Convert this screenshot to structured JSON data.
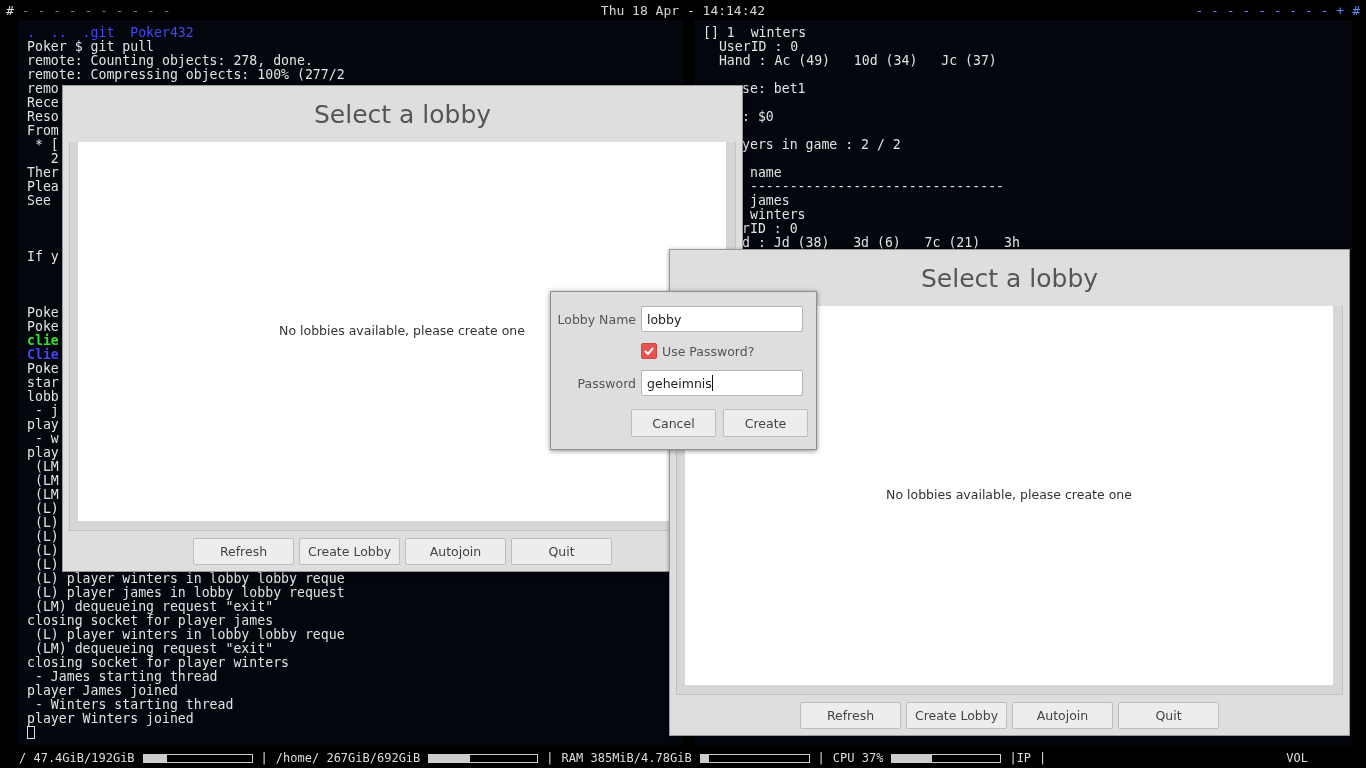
{
  "top_bar": {
    "left_mark": "#",
    "left_tags": "- - - - - - - - - -",
    "clock": "Thu 18 Apr - 14:14:42",
    "right_tags": "- - - - - - - - - +",
    "right_mark": "#"
  },
  "left_terminal": {
    "cursor_visible": true,
    "lines": [
      {
        "kind": "listing",
        "text": ".  ..  .git  Poker432"
      },
      {
        "kind": "plain",
        "text": "Poker $ git pull"
      },
      {
        "kind": "plain",
        "text": "remote: Counting objects: 278, done."
      },
      {
        "kind": "plain",
        "text": "remote: Compressing objects: 100% (277/2"
      },
      {
        "kind": "plain",
        "text": "remo"
      },
      {
        "kind": "plain",
        "text": "Rece"
      },
      {
        "kind": "plain",
        "text": "Reso"
      },
      {
        "kind": "plain",
        "text": "From"
      },
      {
        "kind": "plain",
        "text": " * ["
      },
      {
        "kind": "plain",
        "text": "   2"
      },
      {
        "kind": "plain",
        "text": "Ther"
      },
      {
        "kind": "plain",
        "text": "Plea"
      },
      {
        "kind": "plain",
        "text": "See"
      },
      {
        "kind": "blank"
      },
      {
        "kind": "blank"
      },
      {
        "kind": "blank"
      },
      {
        "kind": "plain",
        "text": "If y"
      },
      {
        "kind": "blank"
      },
      {
        "kind": "blank"
      },
      {
        "kind": "blank"
      },
      {
        "kind": "plain",
        "text": "Poke"
      },
      {
        "kind": "plain",
        "text": "Poke"
      },
      {
        "kind": "success",
        "text": "clie"
      },
      {
        "kind": "info",
        "text": "Clie"
      },
      {
        "kind": "plain",
        "text": "Poke"
      },
      {
        "kind": "plain",
        "text": "star"
      },
      {
        "kind": "plain",
        "text": "lobb"
      },
      {
        "kind": "plain",
        "text": " - j"
      },
      {
        "kind": "plain",
        "text": "play"
      },
      {
        "kind": "plain",
        "text": " - w"
      },
      {
        "kind": "plain",
        "text": "play"
      },
      {
        "kind": "plain",
        "text": " (LM"
      },
      {
        "kind": "plain",
        "text": " (LM"
      },
      {
        "kind": "plain",
        "text": " (LM"
      },
      {
        "kind": "plain",
        "text": " (L)"
      },
      {
        "kind": "plain",
        "text": " (L)"
      },
      {
        "kind": "plain",
        "text": " (L)"
      },
      {
        "kind": "plain",
        "text": " (L)"
      },
      {
        "kind": "plain",
        "text": " (L)"
      },
      {
        "kind": "plain",
        "text": " (L) player winters in lobby lobby reque"
      },
      {
        "kind": "plain",
        "text": " (L) player james in lobby lobby request"
      },
      {
        "kind": "plain",
        "text": " (LM) dequeueing request \"exit\""
      },
      {
        "kind": "plain",
        "text": "closing socket for player james"
      },
      {
        "kind": "plain",
        "text": " (L) player winters in lobby lobby reque"
      },
      {
        "kind": "plain",
        "text": " (LM) dequeueing request \"exit\""
      },
      {
        "kind": "plain",
        "text": "closing socket for player winters"
      },
      {
        "kind": "plain",
        "text": " - James starting thread"
      },
      {
        "kind": "plain",
        "text": "player James joined"
      },
      {
        "kind": "plain",
        "text": " - Winters starting thread"
      },
      {
        "kind": "plain",
        "text": "player Winters joined"
      }
    ]
  },
  "right_terminal": {
    "lines": [
      {
        "kind": "plain",
        "text": "[] 1  winters"
      },
      {
        "kind": "plain",
        "text": "  UserID : 0"
      },
      {
        "kind": "plain",
        "text": "  Hand : Ac (49)   10d (34)   Jc (37)"
      },
      {
        "kind": "blank"
      },
      {
        "kind": "plain",
        "text": "se: bet1"
      },
      {
        "kind": "blank"
      },
      {
        "kind": "plain",
        "text": ": $0"
      },
      {
        "kind": "blank"
      },
      {
        "kind": "plain",
        "text": "yers in game : 2 / 2"
      },
      {
        "kind": "blank"
      },
      {
        "kind": "plain",
        "text": " name"
      },
      {
        "kind": "plain",
        "text": " --------------------------------"
      },
      {
        "kind": "plain",
        "text": " james"
      },
      {
        "kind": "plain",
        "text": " winters"
      },
      {
        "kind": "plain",
        "text": "rID : 0"
      },
      {
        "kind": "plain",
        "text": "d : Jd (38)   3d (6)   7c (21)   3h"
      }
    ]
  },
  "lobby_windows": [
    {
      "title": "Select a lobby",
      "message": "No lobbies available, please create one",
      "buttons": [
        "Refresh",
        "Create Lobby",
        "Autojoin",
        "Quit"
      ]
    },
    {
      "title": "Select a lobby",
      "message": "No lobbies available, please create one",
      "buttons": [
        "Refresh",
        "Create Lobby",
        "Autojoin",
        "Quit"
      ]
    }
  ],
  "create_dialog": {
    "name_label": "Lobby Name",
    "name_value": "lobby",
    "use_password": {
      "label": "Use Password?",
      "checked": true
    },
    "password_label": "Password",
    "password_value": "geheimnis",
    "buttons": [
      "Cancel",
      "Create"
    ]
  },
  "status_bar": {
    "items": [
      {
        "kind": "meter",
        "label": "/ 47.4GiB/192GiB",
        "level": 0.22
      },
      {
        "kind": "text",
        "label": "|"
      },
      {
        "kind": "meter",
        "label": "/home/ 267GiB/692GiB",
        "level": 0.38
      },
      {
        "kind": "text",
        "label": "|"
      },
      {
        "kind": "meter",
        "label": "RAM 385MiB/4.78GiB",
        "level": 0.08
      },
      {
        "kind": "text",
        "label": "|"
      },
      {
        "kind": "meter",
        "label": "CPU 37%",
        "level": 0.37
      },
      {
        "kind": "text",
        "label": "|IP"
      },
      {
        "kind": "text",
        "label": "|"
      }
    ],
    "volume_label": "VOL"
  }
}
